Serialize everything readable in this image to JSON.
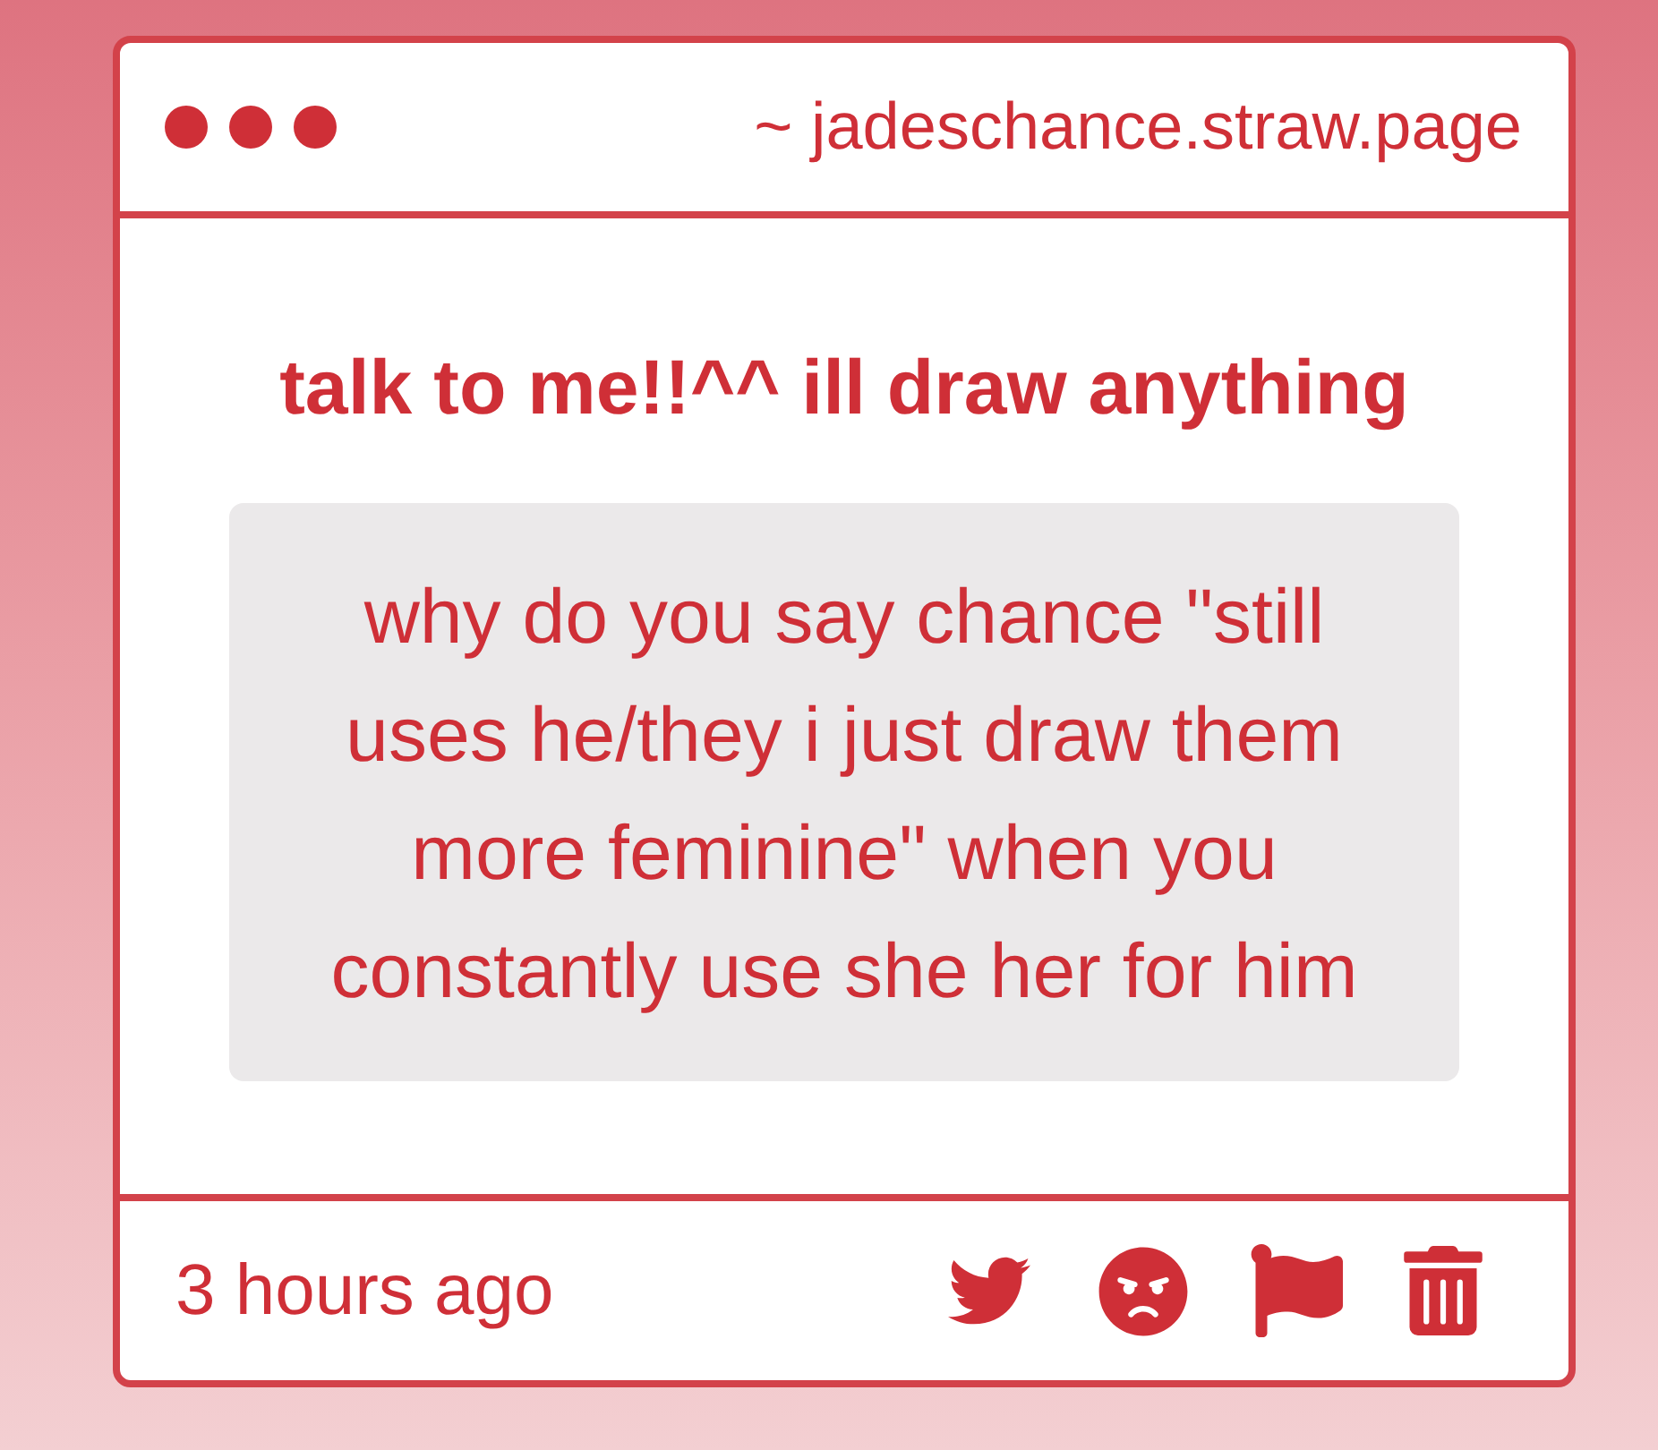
{
  "window": {
    "address": "~ jadeschance.straw.page"
  },
  "post": {
    "title": "talk to me!!^^ ill draw anything",
    "message": "why do you say chance \"still uses he/they i just draw them more feminine\" when you constantly use she her for him"
  },
  "footer": {
    "time": "3 hours ago"
  }
}
